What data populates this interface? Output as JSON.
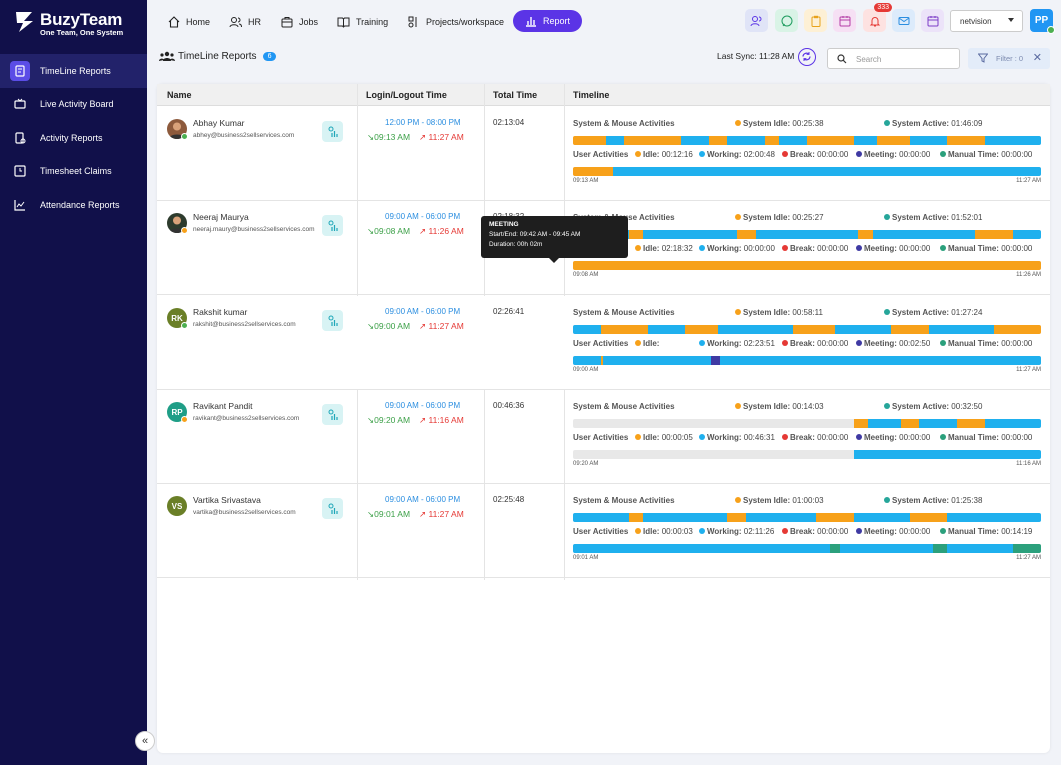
{
  "app": {
    "brand": "BuzyTeam",
    "tagline": "One Team, One System"
  },
  "sidebar": {
    "items": [
      {
        "label": "TimeLine Reports",
        "active": true
      },
      {
        "label": "Live Activity Board"
      },
      {
        "label": "Activity Reports"
      },
      {
        "label": "Timesheet Claims"
      },
      {
        "label": "Attendance Reports"
      }
    ]
  },
  "topnav": {
    "items": [
      {
        "label": "Home"
      },
      {
        "label": "HR"
      },
      {
        "label": "Jobs"
      },
      {
        "label": "Training"
      },
      {
        "label": "Projects/workspace"
      },
      {
        "label": "Report"
      }
    ]
  },
  "header": {
    "notification_count": "333",
    "workspace": "netvision",
    "user_initials": "PP"
  },
  "page": {
    "title": "TimeLine Reports",
    "count": "6",
    "last_sync": "Last Sync: 11:28 AM",
    "search_placeholder": "Search",
    "filter_label": "Filter : 0"
  },
  "table": {
    "columns": [
      "Name",
      "Login/Logout Time",
      "Total Time",
      "Timeline"
    ],
    "labels": {
      "sys": "System & Mouse Activities",
      "sys_idle": "System Idle:",
      "sys_active": "System Active:",
      "user": "User Activities",
      "idle": "Idle:",
      "working": "Working:",
      "break": "Break:",
      "meeting": "Meeting:",
      "manual": "Manual Time:"
    },
    "colors": {
      "idle": "#f7a11a",
      "working": "#1fb0ee",
      "break": "#e53935",
      "meeting": "#3f3aa3",
      "manual": "#2ba07c",
      "active": "#26a69a"
    },
    "rows": [
      {
        "initials": "",
        "name": "Abhay Kumar",
        "email": "abhey@business2sellservices.com",
        "status": "#4caf50",
        "avatar_color": "#8d5a3c",
        "shift": "12:00 PM - 08:00 PM",
        "login": "09:13 AM",
        "logout": "11:27 AM",
        "total": "02:13:04",
        "sys_idle": "00:25:38",
        "sys_active": "01:46:09",
        "idle": "00:12:16",
        "working": "02:00:48",
        "break": "00:00:00",
        "meeting": "00:00:00",
        "manual": "00:00:00",
        "start": "09:13 AM",
        "end": "11:27 AM"
      },
      {
        "initials": "",
        "name": "Neeraj Maurya",
        "email": "neeraj.maury@business2sellservices.com",
        "status": "#f7a11a",
        "avatar_color": "#2d3b2d",
        "shift": "09:00 AM - 06:00 PM",
        "login": "09:08 AM",
        "logout": "11:26 AM",
        "total": "02:18:32",
        "sys_idle": "00:25:27",
        "sys_active": "01:52:01",
        "idle": "02:18:32",
        "working": "00:00:00",
        "break": "00:00:00",
        "meeting": "00:00:00",
        "manual": "00:00:00",
        "start": "09:08 AM",
        "end": "11:26 AM"
      },
      {
        "initials": "RK",
        "name": "Rakshit kumar",
        "email": "rakshit@business2sellservices.com",
        "status": "#4caf50",
        "avatar_color": "#6a7f27",
        "shift": "09:00 AM - 06:00 PM",
        "login": "09:00 AM",
        "logout": "11:27 AM",
        "total": "02:26:41",
        "sys_idle": "00:58:11",
        "sys_active": "01:27:24",
        "idle": "",
        "working": "02:23:51",
        "break": "00:00:00",
        "meeting": "00:02:50",
        "manual": "00:00:00",
        "start": "09:00 AM",
        "end": "11:27 AM"
      },
      {
        "initials": "RP",
        "name": "Ravikant Pandit",
        "email": "ravikant@business2sellservices.com",
        "status": "#f7a11a",
        "avatar_color": "#1f9e87",
        "shift": "09:00 AM - 06:00 PM",
        "login": "09:20 AM",
        "logout": "11:16 AM",
        "total": "00:46:36",
        "sys_idle": "00:14:03",
        "sys_active": "00:32:50",
        "idle": "00:00:05",
        "working": "00:46:31",
        "break": "00:00:00",
        "meeting": "00:00:00",
        "manual": "00:00:00",
        "start": "09:20 AM",
        "end": "11:16 AM"
      },
      {
        "initials": "VS",
        "name": "Vartika Srivastava",
        "email": "vartika@business2sellservices.com",
        "status": "",
        "avatar_color": "#6a7f27",
        "shift": "09:00 AM - 06:00 PM",
        "login": "09:01 AM",
        "logout": "11:27 AM",
        "total": "02:25:48",
        "sys_idle": "01:00:03",
        "sys_active": "01:25:38",
        "idle": "00:00:03",
        "working": "02:11:26",
        "break": "00:00:00",
        "meeting": "00:00:00",
        "manual": "00:14:19",
        "start": "09:01 AM",
        "end": "11:27 AM"
      }
    ]
  },
  "tooltip": {
    "title": "MEETING",
    "range": "Start/End: 09:42 AM - 09:45 AM",
    "duration": "Duration: 00h 02m"
  }
}
